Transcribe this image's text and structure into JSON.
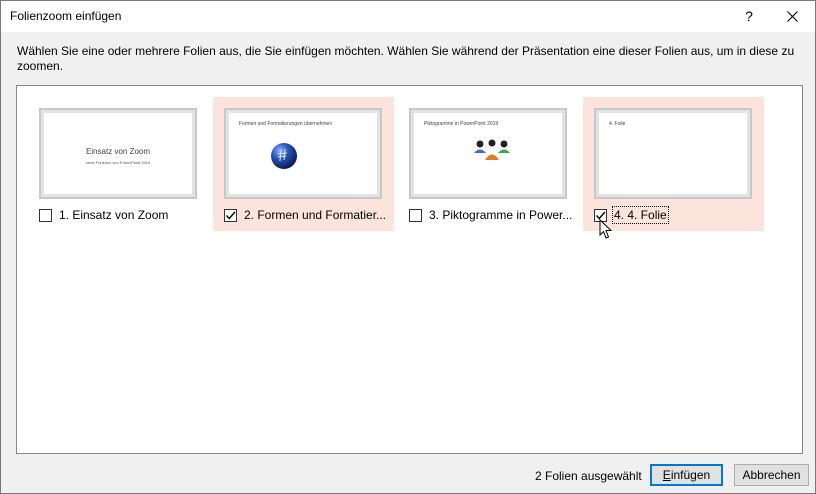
{
  "window": {
    "title": "Folienzoom einfügen",
    "help_label": "?"
  },
  "instruction": "Wählen Sie eine oder mehrere Folien aus, die Sie einfügen möchten. Wählen Sie während der Präsentation eine dieser Folien aus, um in diese zu zoomen.",
  "slides": [
    {
      "label": "1. Einsatz von Zoom",
      "checked": false,
      "thumb_title": "Einsatz von Zoom",
      "thumb_subtitle": "neue Funktion von PowerPoint 2019"
    },
    {
      "label": "2. Formen und Formatier...",
      "checked": true,
      "thumb_title": "Formen und Formatierungen übernehmen"
    },
    {
      "label": "3. Piktogramme in Power...",
      "checked": false,
      "thumb_title": "Piktogramme in PowerPoint 2019"
    },
    {
      "label": "4. 4. Folie",
      "checked": true,
      "thumb_title": "4. Folie"
    }
  ],
  "footer": {
    "status": "2 Folien ausgewählt",
    "insert_prefix": "",
    "insert_underlined": "E",
    "insert_rest": "infügen",
    "cancel_label": "Abbrechen"
  },
  "colors": {
    "selected_bg": "#fce4dc",
    "primary_border": "#0078d7"
  }
}
